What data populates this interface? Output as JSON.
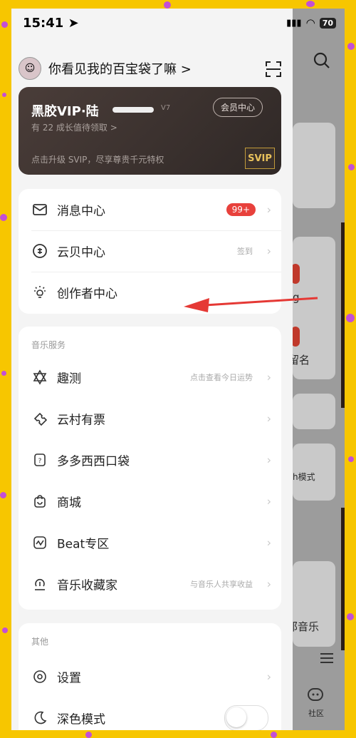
{
  "status": {
    "time": "15:41",
    "battery": "70"
  },
  "user": {
    "name": "你看见我的百宝袋了嘛 >"
  },
  "vip": {
    "title": "黑胶VIP·陆",
    "level": "V7",
    "member_button": "会员中心",
    "subtitle": "有 22 成长值待领取 >",
    "footer": "点击升级 SVIP，尽享尊贵千元特权",
    "svip_badge": "SVIP"
  },
  "main_items": [
    {
      "label": "消息中心",
      "badge": "99+"
    },
    {
      "label": "云贝中心",
      "hint": "签到"
    },
    {
      "label": "创作者中心"
    }
  ],
  "music_services": {
    "title": "音乐服务",
    "items": [
      {
        "label": "趣测",
        "hint": "点击查看今日运势"
      },
      {
        "label": "云村有票"
      },
      {
        "label": "多多西西口袋"
      },
      {
        "label": "商城"
      },
      {
        "label": "Beat专区"
      },
      {
        "label": "音乐收藏家",
        "hint": "与音乐人共享收益"
      }
    ]
  },
  "other": {
    "title": "其他",
    "items": [
      {
        "label": "设置"
      },
      {
        "label": "深色模式"
      }
    ]
  },
  "background": {
    "text_1": "g",
    "text_2": "留名",
    "text_3": "h模式",
    "text_4": "那音乐",
    "text_5": "社区"
  },
  "colors": {
    "badge_red": "#e8413c",
    "arrow_red": "#e53935",
    "frame_yellow": "#f7c600",
    "dot_purple": "#c34fd6"
  }
}
